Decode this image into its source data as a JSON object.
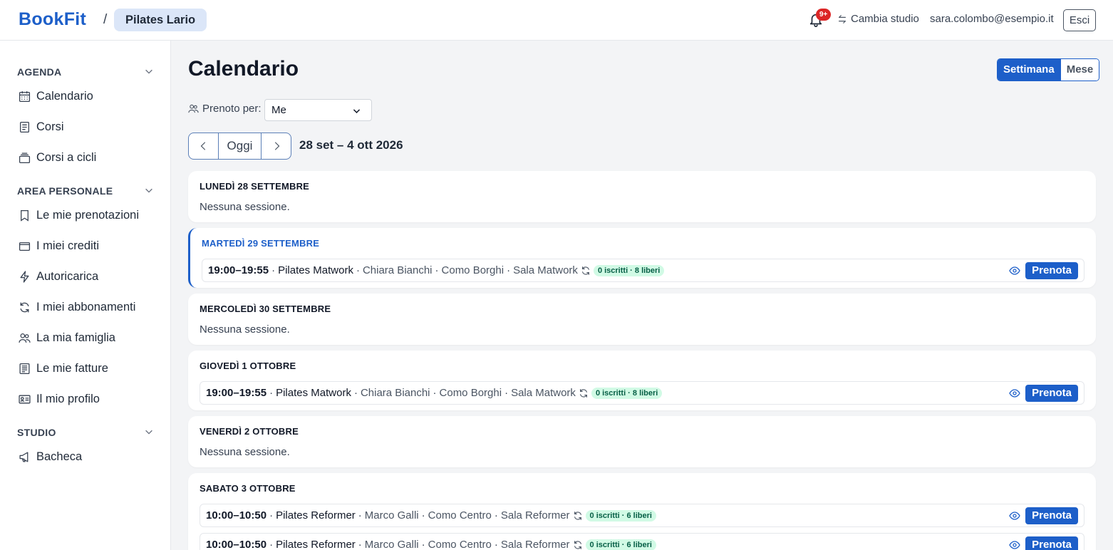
{
  "header": {
    "logo": "BookFit",
    "separator": "/",
    "studio": "Pilates Lario",
    "notifications_badge": "9+",
    "switch_studio": "Cambia studio",
    "email": "sara.colombo@esempio.it",
    "logout": "Esci"
  },
  "sidebar": {
    "sections": [
      {
        "title": "AGENDA",
        "items": [
          {
            "label": "Calendario",
            "icon": "calendar-icon"
          },
          {
            "label": "Corsi",
            "icon": "book-icon"
          },
          {
            "label": "Corsi a cicli",
            "icon": "stack-icon"
          }
        ]
      },
      {
        "title": "AREA PERSONALE",
        "items": [
          {
            "label": "Le mie prenotazioni",
            "icon": "bookmark-icon"
          },
          {
            "label": "I miei crediti",
            "icon": "wallet-icon"
          },
          {
            "label": "Autoricarica",
            "icon": "bolt-icon"
          },
          {
            "label": "I miei abbonamenti",
            "icon": "refresh-icon"
          },
          {
            "label": "La mia famiglia",
            "icon": "people-icon"
          },
          {
            "label": "Le mie fatture",
            "icon": "invoice-icon"
          },
          {
            "label": "Il mio profilo",
            "icon": "id-card-icon"
          }
        ]
      },
      {
        "title": "STUDIO",
        "items": [
          {
            "label": "Bacheca",
            "icon": "megaphone-icon"
          }
        ]
      }
    ]
  },
  "main": {
    "title": "Calendario",
    "view_week": "Settimana",
    "view_month": "Mese",
    "book_for_label": "Prenoto per:",
    "book_for_value": "Me",
    "today_button": "Oggi",
    "range": "28 set – 4 ott 2026",
    "empty_text": "Nessuna sessione.",
    "book_label": "Prenota",
    "accent": "#1d5fc9",
    "days": [
      {
        "title": "LUNEDÌ 28 SETTEMBRE",
        "sessions": []
      },
      {
        "title": "MARTEDÌ 29 SETTEMBRE",
        "today": true,
        "sessions": [
          {
            "time": "19:00–19:55",
            "course": "Pilates Matwork",
            "teacher": "Chiara Bianchi",
            "location": "Como Borghi",
            "room": "Sala Matwork",
            "availability": "0 iscritti · 8 liberi"
          }
        ]
      },
      {
        "title": "MERCOLEDÌ 30 SETTEMBRE",
        "sessions": []
      },
      {
        "title": "GIOVEDÌ 1 OTTOBRE",
        "sessions": [
          {
            "time": "19:00–19:55",
            "course": "Pilates Matwork",
            "teacher": "Chiara Bianchi",
            "location": "Como Borghi",
            "room": "Sala Matwork",
            "availability": "0 iscritti · 8 liberi"
          }
        ]
      },
      {
        "title": "VENERDÌ 2 OTTOBRE",
        "sessions": []
      },
      {
        "title": "SABATO 3 OTTOBRE",
        "sessions": [
          {
            "time": "10:00–10:50",
            "course": "Pilates Reformer",
            "teacher": "Marco Galli",
            "location": "Como Centro",
            "room": "Sala Reformer",
            "availability": "0 iscritti · 6 liberi"
          },
          {
            "time": "10:00–10:50",
            "course": "Pilates Reformer",
            "teacher": "Marco Galli",
            "location": "Como Centro",
            "room": "Sala Reformer",
            "availability": "0 iscritti · 6 liberi"
          }
        ]
      }
    ]
  }
}
